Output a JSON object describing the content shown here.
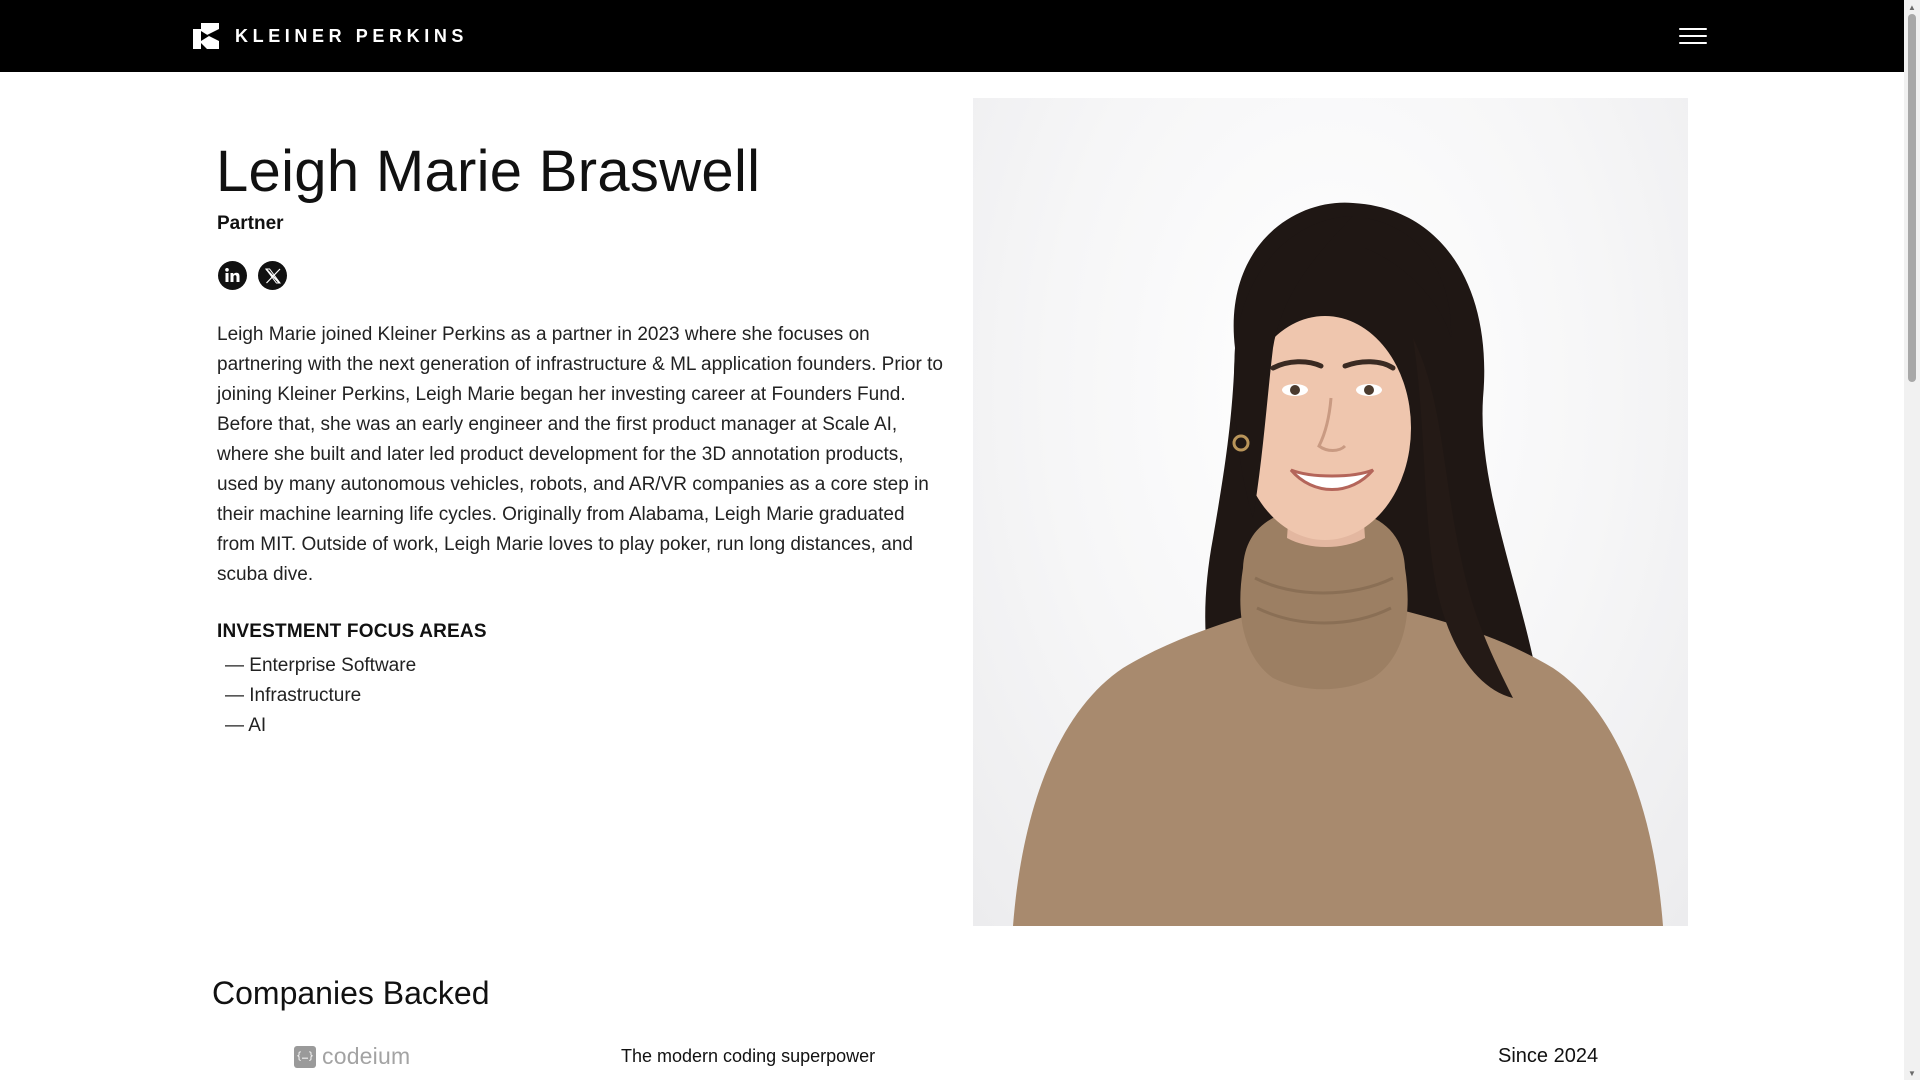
{
  "nav": {
    "brand": "KLEINER PERKINS",
    "menu_icon": "hamburger-menu-icon"
  },
  "profile": {
    "name": "Leigh Marie Braswell",
    "role": "Partner",
    "socials": [
      {
        "icon": "linkedin-icon"
      },
      {
        "icon": "x-twitter-icon"
      }
    ],
    "bio": "Leigh Marie joined Kleiner Perkins as a partner in 2023 where she focuses on partnering with the next generation of infrastructure & ML application founders. Prior to joining Kleiner Perkins, Leigh Marie began her investing career at Founders Fund. Before that, she was an early engineer and the first product manager at Scale AI, where she built and later led product development for the 3D annotation products, used by many autonomous vehicles, robots, and AR/VR companies as a core step in their machine learning life cycles. Originally from Alabama, Leigh Marie graduated from MIT. Outside of work, Leigh Marie loves to play poker, run long distances, and scuba dive.",
    "focus_title": "INVESTMENT FOCUS AREAS",
    "focus_areas": [
      "— Enterprise Software",
      "— Infrastructure",
      "— AI"
    ]
  },
  "companies": {
    "title": "Companies Backed",
    "items": [
      {
        "logo_text": "codeium",
        "logo_mark": "{…}",
        "tagline": "The modern coding superpower",
        "since": "Since 2024"
      }
    ]
  },
  "colors": {
    "nav_bg": "#000000",
    "text": "#111111",
    "logo_gray": "#a3a3a3",
    "sweater": "#a88a6e",
    "hair": "#1f1714"
  }
}
